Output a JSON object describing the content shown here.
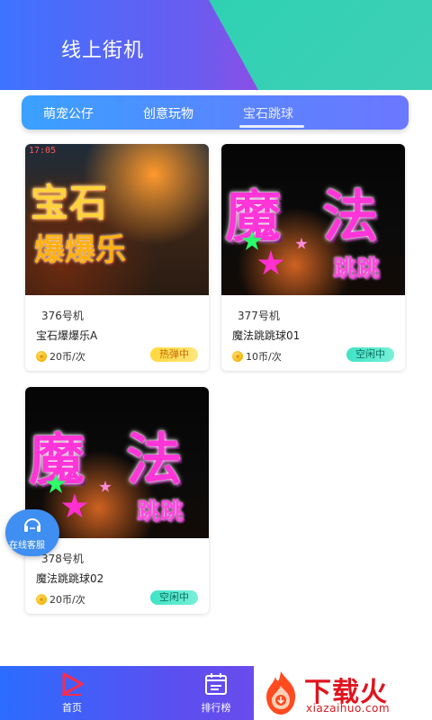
{
  "header": {
    "title": "线上街机"
  },
  "tabs": [
    {
      "label": "萌宠公仔",
      "active": false
    },
    {
      "label": "创意玩物",
      "active": false
    },
    {
      "label": "宝石跳球",
      "active": true
    }
  ],
  "cards": [
    {
      "machine_no": "376号机",
      "name": "宝石爆爆乐A",
      "price": "20币/次",
      "status": "热弹中",
      "thumb": {
        "line1": "宝石",
        "line2": "爆爆乐",
        "time": "17:05"
      }
    },
    {
      "machine_no": "377号机",
      "name": "魔法跳跳球01",
      "price": "10币/次",
      "status": "空闲中",
      "thumb": {
        "line1a": "魔",
        "line1b": "法",
        "line2": "跳跳"
      }
    },
    {
      "machine_no": "378号机",
      "name": "魔法跳跳球02",
      "price": "20币/次",
      "status": "空闲中",
      "thumb": {
        "line1a": "魔",
        "line1b": "法",
        "line2": "跳跳"
      }
    }
  ],
  "service": {
    "label": "在线客服",
    "icon": "headset-icon"
  },
  "bottom_nav": [
    {
      "label": "首页",
      "icon": "play-icon"
    },
    {
      "label": "排行榜",
      "icon": "calendar-icon"
    }
  ],
  "watermark": {
    "brand": "下载火",
    "url": "xiazaihuo.com"
  },
  "colors": {
    "header_blue": "#3d73ff",
    "header_teal": "#2fd1b3",
    "hot_badge": "#ffd93d",
    "idle_badge": "#3fe3c6",
    "nav_bg": "#5b4ff0"
  }
}
